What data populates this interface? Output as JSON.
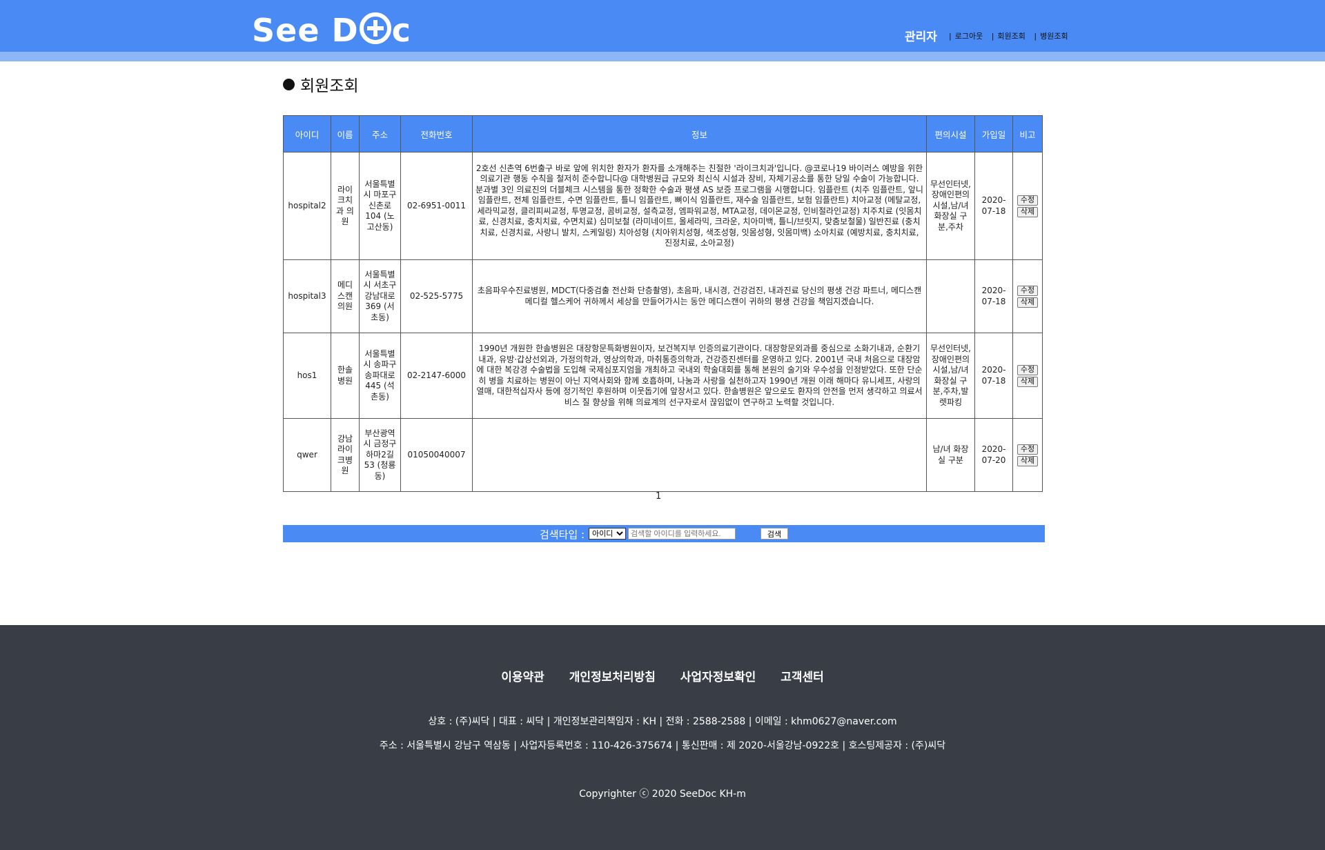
{
  "header": {
    "logo_text": "See Doc",
    "admin": "관리자",
    "nav": [
      "로그아웃",
      "회원조회",
      "병원조회"
    ]
  },
  "page_title": "회원조회",
  "table": {
    "headers": [
      "아이디",
      "이름",
      "주소",
      "전화번호",
      "정보",
      "편의시설",
      "가입일",
      "비고"
    ],
    "edit_label": "수정",
    "delete_label": "삭제",
    "rows": [
      {
        "id": "hospital2",
        "name": "라이크치과 의원",
        "address": "서울특별시 마포구 신촌로 104 (노고산동)",
        "phone": "02-6951-0011",
        "info": "2호선 신촌역 6번출구 바로 앞에 위치한 환자가 환자를 소개해주는 친절한 '라이크치과'입니다. @코로나19 바이러스 예방을 위한 의료기관 행동 수칙을 철저히 준수합니다@ 대학병원급 규모와 최신식 시설과 장비, 자체기공소를 통한 당일 수술이 가능합니다. 분과별 3인 의료진의 더블체크 시스템을 통한 정확한 수술과 평생 AS 보증 프로그램을 시행합니다. 임플란트 (치주 임플란트, 앞니 임플란트, 전체 임플란트, 수면 임플란트, 틀니 임플란트, 뼈이식 임플란트, 재수술 임플란트, 보험 임플란트)       치아교정 (메탈교정, 세라믹교정, 클리피씨교정, 투명교정, 콤비교정, 설측교정, 엠파워교정, MTA교정, 데이몬교정, 인비절라인교정)       치주치료 (잇몸치료, 신경치료, 충치치료, 수면치료)        심미보철 (라미네이트, 올세라믹, 크라운, 치아미백, 틀니/브릿지, 맞춤보철물)        일반진료 (충치치료, 신경치료, 사랑니 발치, 스케일링) 치아성형 (치아위치성형, 색조성형, 잇몸성형, 잇몸미백)        소아치료 (예방치료, 충치치료, 진정치료, 소아교정)",
        "facilities": "무선인터넷,장애인편의시설,남/녀 화장실 구분,주차",
        "joined": "2020-07-18"
      },
      {
        "id": "hospital3",
        "name": "메디스캔의원",
        "address": "서울특별시 서초구 강남대로 369 (서초동)",
        "phone": "02-525-5775",
        "info": "초음파우수진료병원, MDCT(다중검출 전산화 단층촬영), 초음파, 내시경, 건강검진, 내과진료 당신의 평생 건강 파트너, 메디스캔 메디컬 헬스케어 귀하께서 세상을 만들어가시는 동안 메디스캔이 귀하의 평생 건강을 책임지겠습니다.",
        "facilities": "",
        "joined": "2020-07-18"
      },
      {
        "id": "hos1",
        "name": "한솔병원",
        "address": "서울특별시 송파구 송파대로 445 (석촌동)",
        "phone": "02-2147-6000",
        "info": "1990년 개원한 한솔병원은 대장항문특화병원이자, 보건복지부 인증의료기관이다. 대장항문외과를 중심으로 소화기내과, 순환기내과, 유방·갑상선외과, 가정의학과, 영상의학과, 마취통증의학과, 건강증진센터를 운영하고 있다. 2001년 국내 처음으로 대장암에 대한 복강경 수술법을 도입해 국제심포지엄을 개최하고 국내외 학술대회를 통해 본원의 술기와 우수성을 인정받았다. 또한 단순히 병을 치료하는 병원이 아닌 지역사회와 함께 호흡하며, 나눔과 사랑을 실천하고자 1990년 개원 이래 해마다 유니세프, 사랑의 열매, 대한적십자사 등에 정기적인 후원하며 이웃돕기에 앞장서고 있다. 한솔병원은 앞으로도 환자의 안전을 먼저 생각하고 의료서비스 질 향상을 위해 의료계의 선구자로서 끊임없이 연구하고 노력할 것입니다.",
        "facilities": "무선인터넷,장애인편의시설,남/녀 화장실 구분,주차,발렛파킹",
        "joined": "2020-07-18"
      },
      {
        "id": "qwer",
        "name": "강남라이크병원",
        "address": "부산광역시 금정구 하마2길 53 (청룡동)",
        "phone": "01050040007",
        "info": "",
        "facilities": "남/녀 화장실 구분",
        "joined": "2020-07-20"
      }
    ]
  },
  "pager": "1",
  "search": {
    "label": "검색타입 :",
    "select_value": "아이디",
    "placeholder": "검색할 아이디를 입력하세요.",
    "button": "검색"
  },
  "footer": {
    "links": [
      "이용약관",
      "개인정보처리방침",
      "사업자정보확인",
      "고객센터"
    ],
    "info1": "상호 : (주)씨닥 | 대표 : 씨닥 | 개인정보관리책임자 : KH | 전화 : 2588-2588 | 이메일 : khm0627@naver.com",
    "info2": "주소 : 서울특별시 강남구 역삼동 | 사업자등록번호 : 110-426-375674 | 통신판매 : 제 2020-서울강남-0922호 | 호스팅제공자 : (주)씨닥",
    "copyright": "Copyrighter ⓒ 2020 SeeDoc KH-m"
  }
}
